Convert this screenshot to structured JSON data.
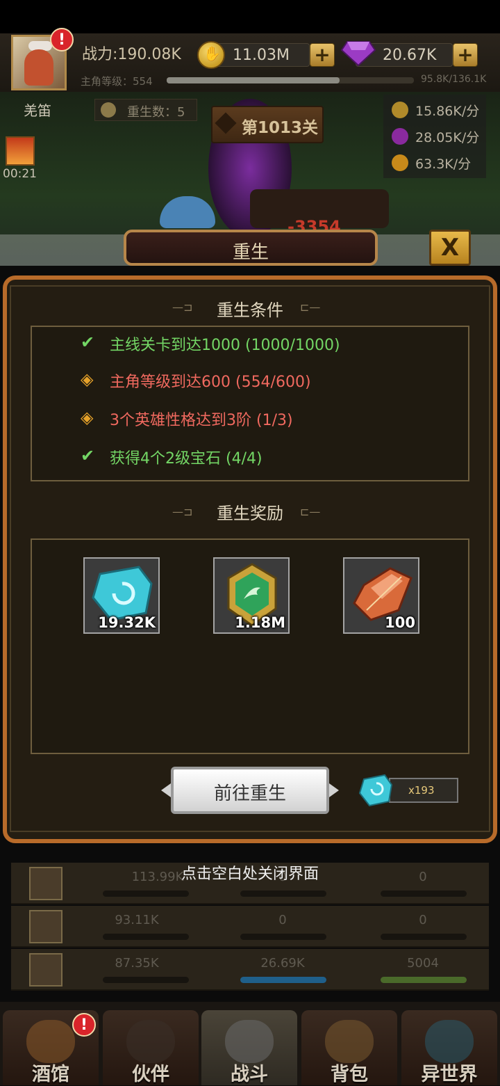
{
  "header": {
    "power": "战力:190.08K",
    "gold": "11.03M",
    "gems": "20.67K",
    "level_label": "主角等级：554",
    "level_progress": "95.8K/136.1K",
    "level_fraction": 0.7
  },
  "scene": {
    "player_name": "羌笛",
    "rebirth_count": "重生数：5",
    "stage": "第1013关",
    "timer": "00:21",
    "damage": "-3354",
    "rates": [
      {
        "icon": "coin-icon",
        "value": "15.86K/分"
      },
      {
        "icon": "exp-icon",
        "value": "28.05K/分"
      },
      {
        "icon": "fire-icon",
        "value": "63.3K/分"
      }
    ]
  },
  "dialog": {
    "title": "重生",
    "close": "X",
    "conditions_title": "重生条件",
    "conditions": [
      {
        "text": "主线关卡到达1000 (1000/1000)",
        "done": true
      },
      {
        "text": "主角等级到达600 (554/600)",
        "done": false
      },
      {
        "text": "3个英雄性格达到3阶 (1/3)",
        "done": false
      },
      {
        "text": "获得4个2级宝石 (4/4)",
        "done": true
      }
    ],
    "rewards_title": "重生奖励",
    "rewards": [
      {
        "icon": "blue-rune-stone-icon",
        "count": "19.32K"
      },
      {
        "icon": "green-wing-badge-icon",
        "count": "1.18M"
      },
      {
        "icon": "red-crystal-icon",
        "count": "100"
      }
    ],
    "go_button": "前往重生",
    "stone_count": "x193"
  },
  "hint": "点击空白处关闭界面",
  "hero_rows": [
    {
      "col1": "113.99K",
      "col2": "0",
      "col3": "0"
    },
    {
      "col1": "93.11K",
      "col2": "0",
      "col3": "0"
    },
    {
      "col1": "87.35K",
      "col2": "26.69K",
      "col3": "5004"
    }
  ],
  "nav": {
    "tabs": [
      "酒馆",
      "伙伴",
      "战斗",
      "背包",
      "异世界"
    ]
  }
}
